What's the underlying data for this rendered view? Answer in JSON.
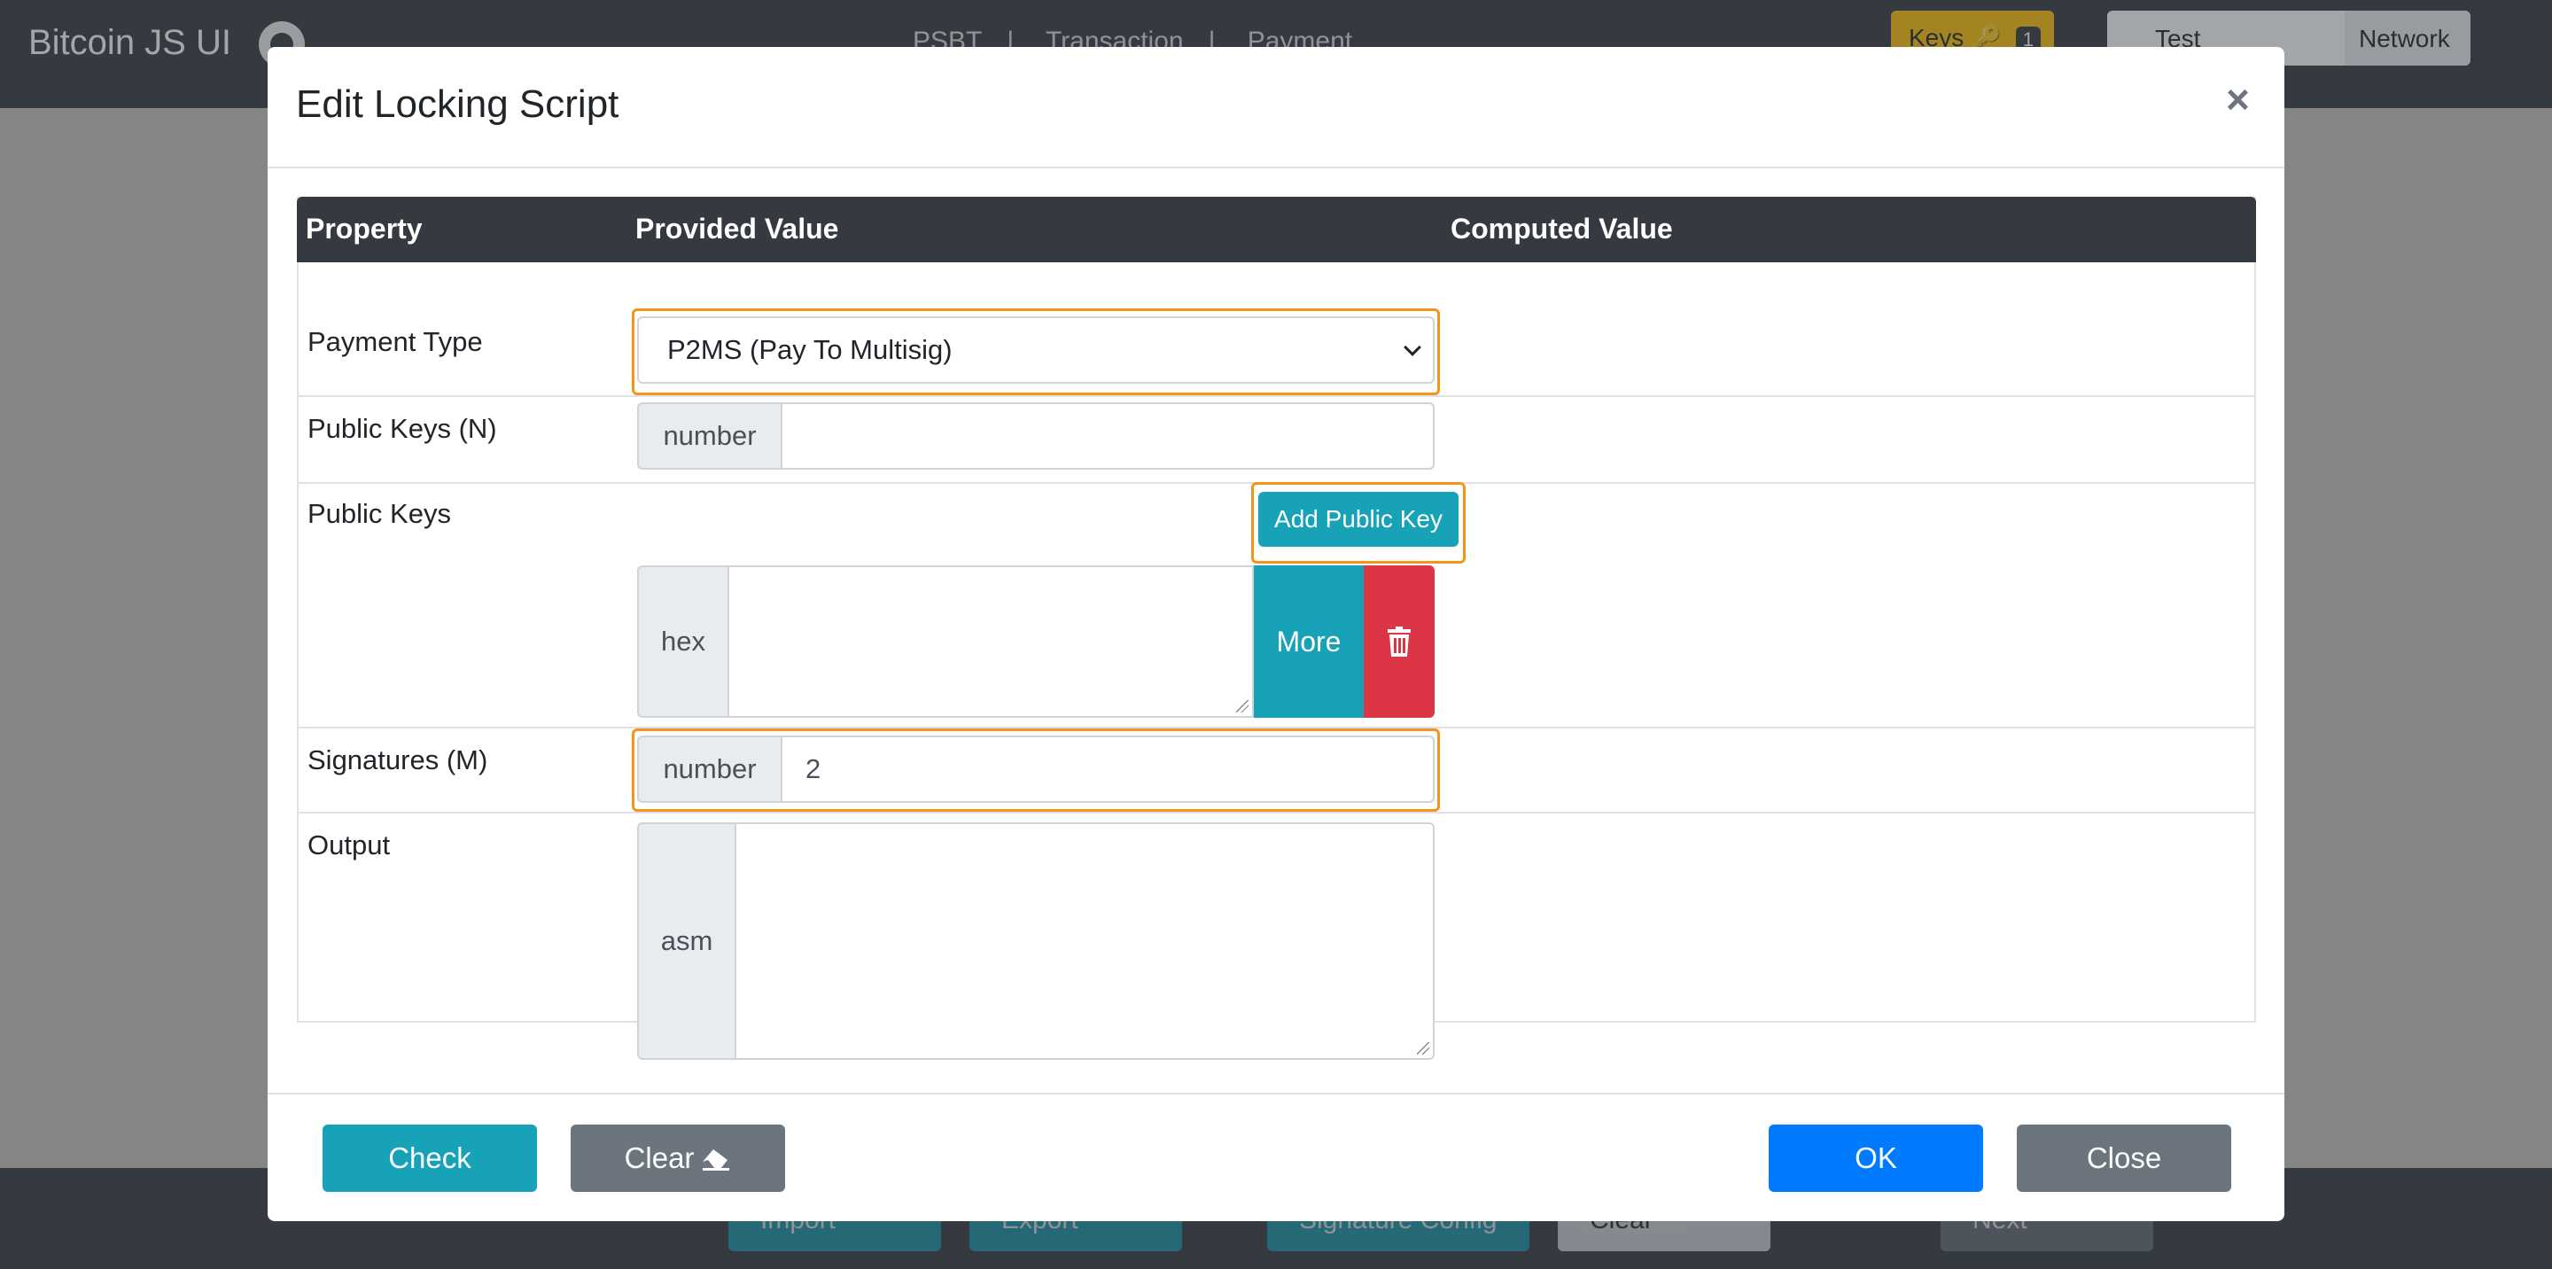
{
  "background": {
    "brand": "Bitcoin JS UI",
    "nav_links": [
      "PSBT",
      "Transaction",
      "Payment"
    ],
    "keys_label": "Keys",
    "keys_count": "1",
    "network_value": "Test",
    "network_label": "Network",
    "footer_buttons": [
      "Import",
      "Export",
      "Signature Config",
      "Clear",
      "Next"
    ]
  },
  "modal": {
    "title": "Edit Locking Script",
    "close_symbol": "×",
    "table": {
      "headers": [
        "Property",
        "Provided Value",
        "Computed Value"
      ],
      "rows": {
        "payment_type": {
          "label": "Payment Type",
          "value": "P2MS (Pay To Multisig)"
        },
        "public_keys_n": {
          "label": "Public Keys (N)",
          "addon": "number",
          "value": ""
        },
        "public_keys": {
          "label": "Public Keys",
          "add_button": "Add Public Key",
          "addon": "hex",
          "value": "",
          "more_button": "More"
        },
        "signatures_m": {
          "label": "Signatures (M)",
          "addon": "number",
          "value": "2"
        },
        "output": {
          "label": "Output",
          "addon": "asm",
          "value": ""
        }
      }
    },
    "footer": {
      "check": "Check",
      "clear": "Clear",
      "ok": "OK",
      "close": "Close"
    }
  },
  "colors": {
    "primary": "#007bff",
    "info": "#17a2b8",
    "danger": "#dc3545",
    "secondary": "#6c757d",
    "focus": "#f7931a",
    "dark": "#343a40"
  }
}
